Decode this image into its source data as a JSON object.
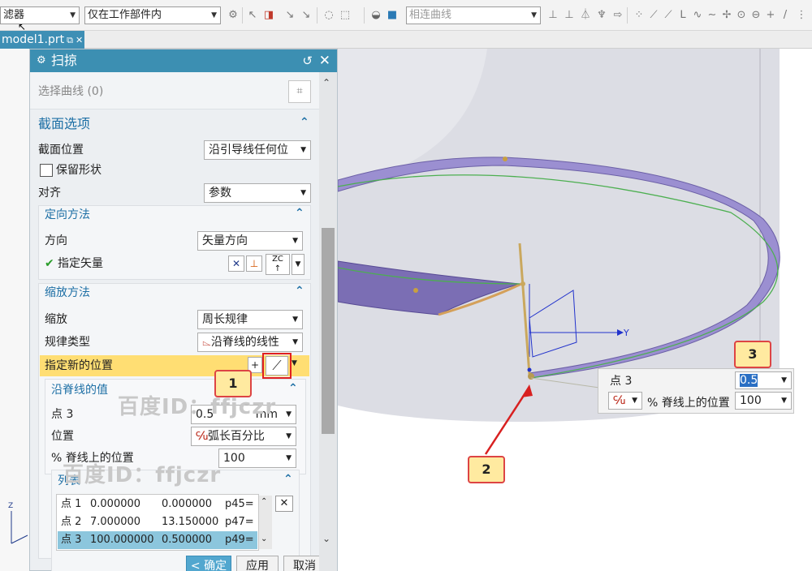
{
  "toolbar": {
    "filter_select": "滤器",
    "scope_select": "仅在工作部件内",
    "curve_rule_select": "相连曲线"
  },
  "tab": {
    "filename": "model1.prt"
  },
  "dialog": {
    "title": "扫掠",
    "select_curve": "选择曲线 (0)",
    "section_options": {
      "header": "截面选项",
      "position_label": "截面位置",
      "position_value": "沿引导线任何位",
      "preserve_shape": "保留形状",
      "align_label": "对齐",
      "align_value": "参数"
    },
    "orientation": {
      "header": "定向方法",
      "direction_label": "方向",
      "direction_value": "矢量方向",
      "vector_label": "指定矢量"
    },
    "scaling": {
      "header": "缩放方法",
      "scale_label": "缩放",
      "scale_value": "周长规律",
      "law_label": "规律类型",
      "law_value": "沿脊线的线性",
      "new_pos_label": "指定新的位置"
    },
    "spine_values": {
      "header": "沿脊线的值",
      "point_label": "点 3",
      "point_value": "0.5",
      "point_unit": "mm",
      "position_label": "位置",
      "position_value": "弧长百分比",
      "pct_label": "% 脊线上的位置",
      "pct_value": "100"
    },
    "list": {
      "header": "列表",
      "rows": [
        {
          "name": "点 1",
          "a": "0.000000",
          "b": "0.000000",
          "c": "p45="
        },
        {
          "name": "点 2",
          "a": "7.000000",
          "b": "13.150000",
          "c": "p47="
        },
        {
          "name": "点 3",
          "a": "100.000000",
          "b": "0.500000",
          "c": "p49="
        }
      ]
    },
    "buttons": {
      "ok": "< 确定 >",
      "apply": "应用",
      "cancel": "取消"
    }
  },
  "float_panel": {
    "point_label": "点 3",
    "value": "0.5",
    "pct_label": "% 脊线上的位置",
    "pct_value": "100"
  },
  "callouts": [
    "1",
    "2",
    "3"
  ],
  "axis_y": "Y",
  "watermark": "百度ID：ffjczr",
  "colors": {
    "accent": "#3c8fb2",
    "highlight": "#ffde73",
    "ribbon": "#9b8fd1",
    "callout_border": "#dd4444"
  }
}
